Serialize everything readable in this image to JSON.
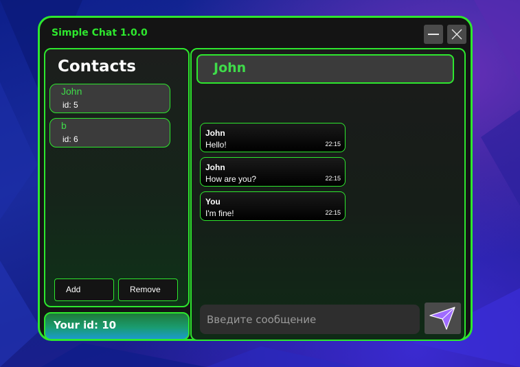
{
  "window": {
    "title": "Simple Chat 1.0.0"
  },
  "contacts": {
    "heading": "Contacts",
    "items": [
      {
        "name": "John",
        "id": "id: 5"
      },
      {
        "name": "b",
        "id": "id: 6"
      }
    ],
    "add_label": "Add",
    "remove_label": "Remove"
  },
  "user": {
    "your_id": "Your id: 10"
  },
  "chat": {
    "header": "John",
    "messages": [
      {
        "author": "John",
        "text": "Hello!",
        "time": "22:15"
      },
      {
        "author": "John",
        "text": "How are you?",
        "time": "22:15"
      },
      {
        "author": "You",
        "text": "I'm fine!",
        "time": "22:15"
      }
    ],
    "input_placeholder": "Введите сообщение"
  },
  "colors": {
    "accent": "#2ee82e",
    "send_icon": "#a06cff"
  },
  "icons": {
    "minimize": "minimize-icon",
    "close": "close-icon",
    "send": "send-arrow-icon"
  }
}
